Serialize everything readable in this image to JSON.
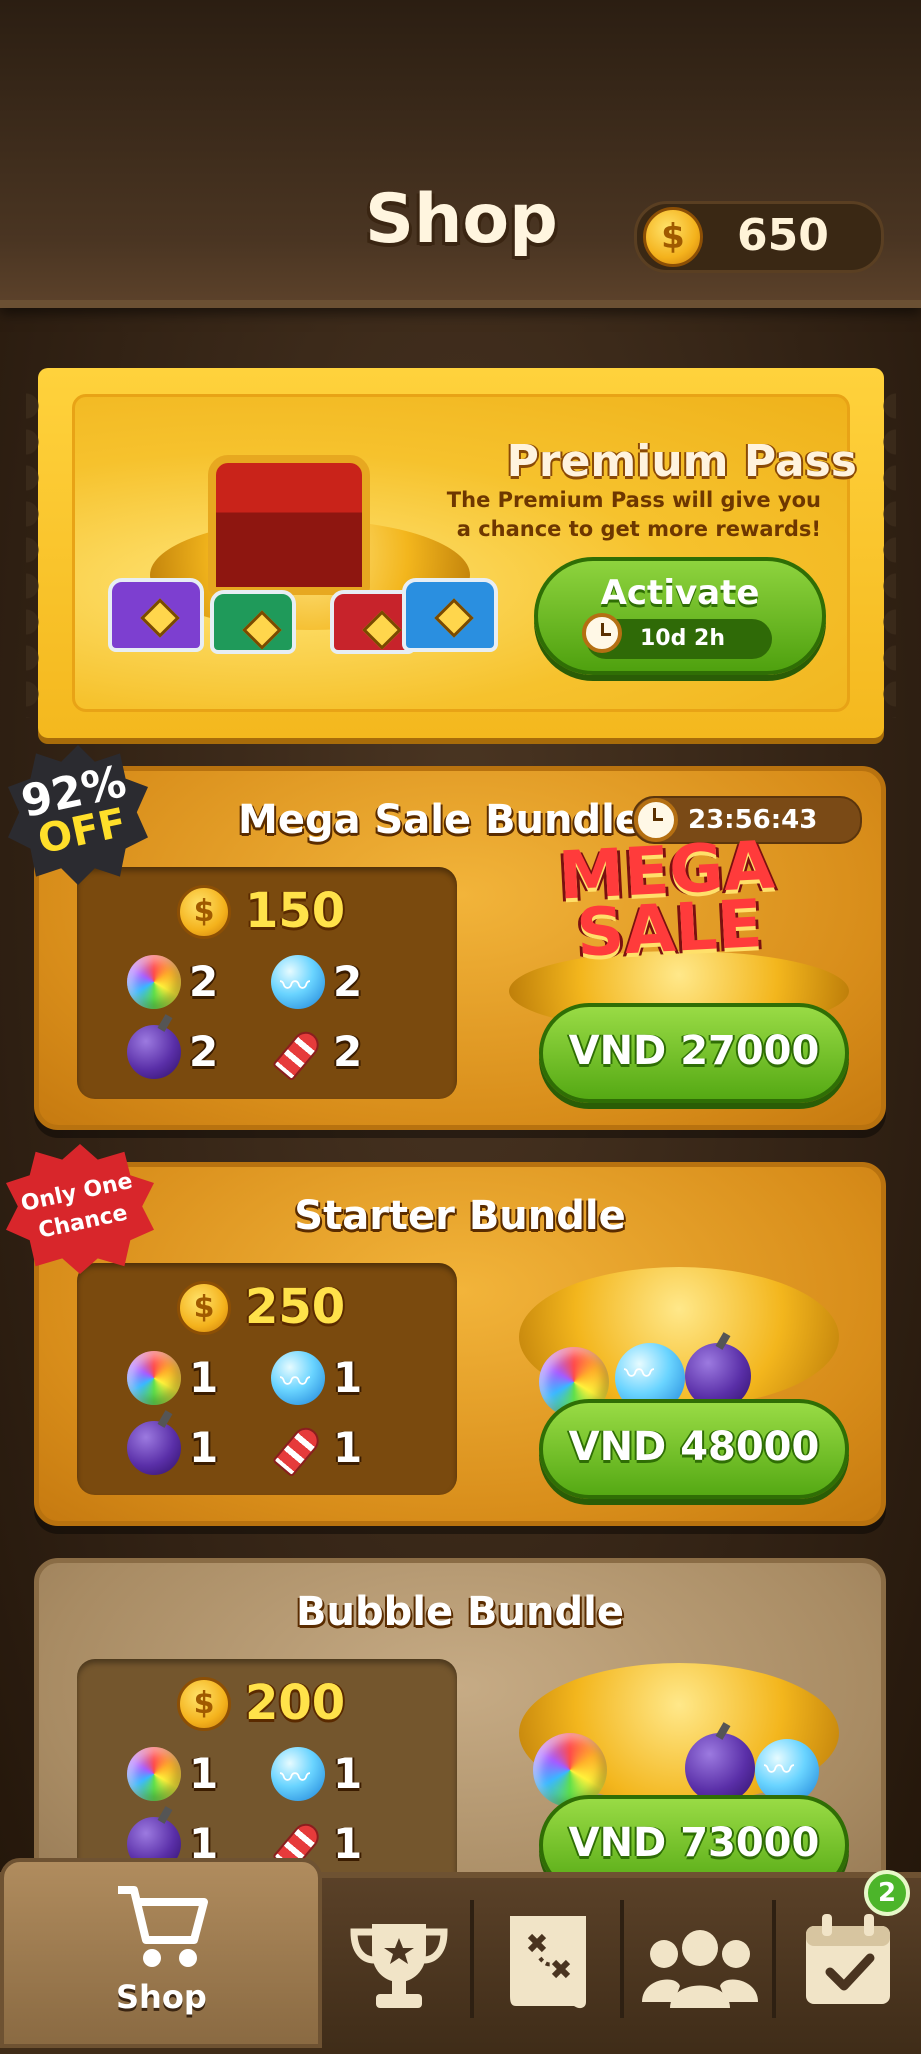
{
  "header": {
    "title": "Shop",
    "coin_balance": "650",
    "coin_symbol": "$"
  },
  "premium_pass": {
    "title": "Premium Pass",
    "description_line1": "The Premium Pass will give you",
    "description_line2": "a chance to get more rewards!",
    "button_label": "Activate",
    "timer": "10d 2h"
  },
  "bundles": [
    {
      "title": "Mega Sale Bundle",
      "timer": "23:56:43",
      "badge_pct": "92%",
      "badge_off": "OFF",
      "art_line1": "MEGA",
      "art_line2": "SALE",
      "coins": "150",
      "rainbow_qty": "2",
      "lightning_qty": "2",
      "bomb_qty": "2",
      "rocket_qty": "2",
      "price": "VND 27000"
    },
    {
      "title": "Starter Bundle",
      "badge_line1": "Only One",
      "badge_line2": "Chance",
      "coins": "250",
      "rainbow_qty": "1",
      "lightning_qty": "1",
      "bomb_qty": "1",
      "rocket_qty": "1",
      "price": "VND 48000"
    },
    {
      "title": "Bubble Bundle",
      "coins": "200",
      "rainbow_qty": "1",
      "lightning_qty": "1",
      "bomb_qty": "1",
      "rocket_qty": "1",
      "price": "VND 73000"
    }
  ],
  "nav": {
    "shop_label": "Shop",
    "calendar_badge": "2",
    "icons": [
      "cart-icon",
      "trophy-icon",
      "map-icon",
      "friends-icon",
      "calendar-icon"
    ]
  }
}
